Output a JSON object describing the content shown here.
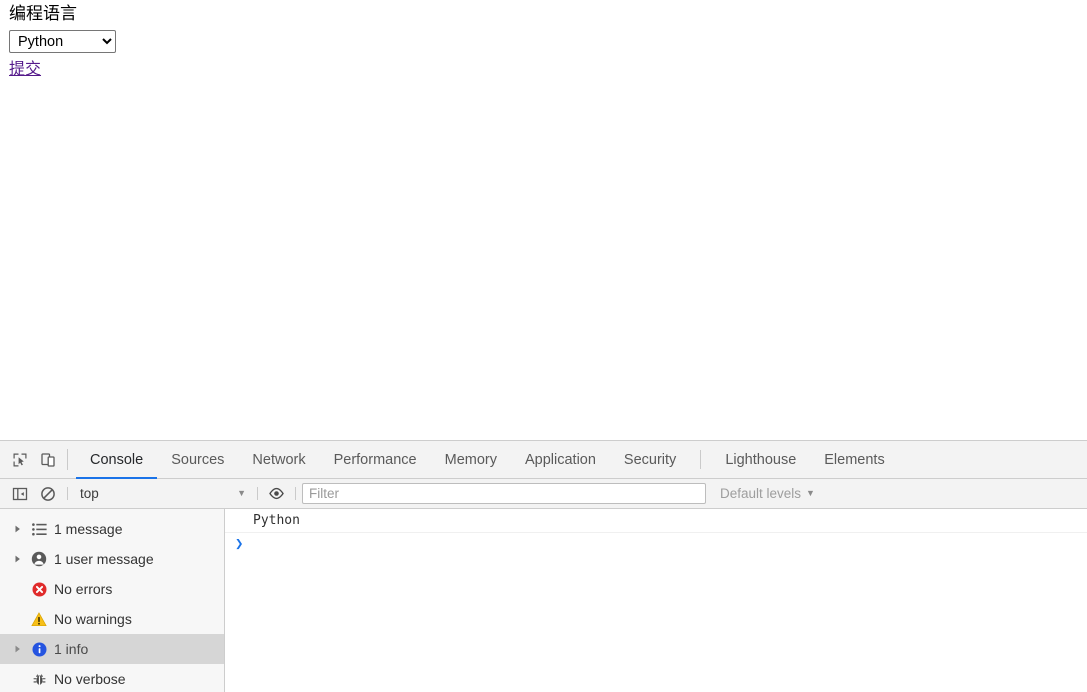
{
  "page": {
    "heading": "编程语言",
    "select": {
      "name": "language-select",
      "value": "Python",
      "options": [
        "Python"
      ]
    },
    "submit_link": "提交"
  },
  "devtools": {
    "toolbar_icons": [
      {
        "name": "inspect-element-icon",
        "title": "Inspect element"
      },
      {
        "name": "device-toolbar-icon",
        "title": "Toggle device toolbar"
      }
    ],
    "tabs": [
      {
        "label": "Console",
        "active": true
      },
      {
        "label": "Sources",
        "active": false
      },
      {
        "label": "Network",
        "active": false
      },
      {
        "label": "Performance",
        "active": false
      },
      {
        "label": "Memory",
        "active": false
      },
      {
        "label": "Application",
        "active": false
      },
      {
        "label": "Security",
        "active": false
      },
      {
        "label": "Lighthouse",
        "active": false,
        "after_separator": true
      },
      {
        "label": "Elements",
        "active": false
      }
    ],
    "filterbar": {
      "sidebar_toggle_icon": "console-sidebar-toggle-icon",
      "clear_icon": "clear-console-icon",
      "context": "top",
      "context_caret": "▼",
      "eye_icon": "live-expression-eye-icon",
      "filter_placeholder": "Filter",
      "filter_value": "",
      "levels_label": "Default levels",
      "levels_caret": "▼"
    },
    "sidebar": [
      {
        "label": "1 message",
        "icon": "list-icon",
        "arrow": true,
        "selected": false
      },
      {
        "label": "1 user message",
        "icon": "user-icon",
        "arrow": true,
        "selected": false
      },
      {
        "label": "No errors",
        "icon": "error-icon",
        "arrow": false,
        "selected": false
      },
      {
        "label": "No warnings",
        "icon": "warning-icon",
        "arrow": false,
        "selected": false
      },
      {
        "label": "1 info",
        "icon": "info-icon",
        "arrow": true,
        "selected": true
      },
      {
        "label": "No verbose",
        "icon": "verbose-bug-icon",
        "arrow": false,
        "selected": false
      }
    ],
    "messages": [
      {
        "text": "Python"
      }
    ],
    "prompt_caret": "❯"
  },
  "colors": {
    "accent_blue": "#1a73e8",
    "error_red": "#e53935",
    "warning_yellow": "#f5c518",
    "info_blue": "#2a5ee8",
    "link_purple": "#551A8B",
    "toolbar_bg": "#f3f3f3",
    "sidebar_bg": "#f7f7f7",
    "selected_bg": "#d6d6d6"
  }
}
